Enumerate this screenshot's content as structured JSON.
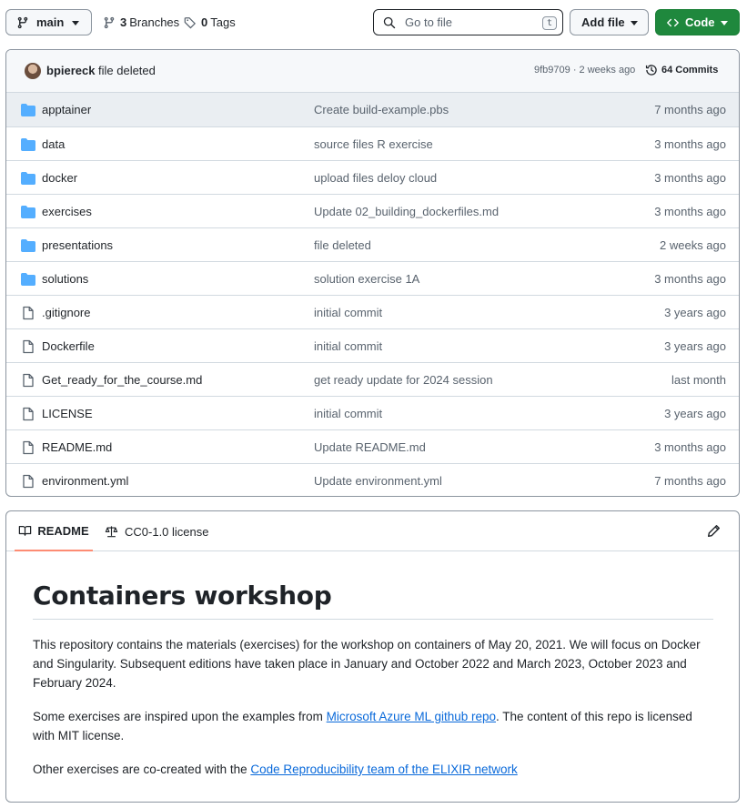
{
  "toolbar": {
    "branch": "main",
    "branches_count": "3",
    "branches_label": "Branches",
    "tags_count": "0",
    "tags_label": "Tags",
    "search_placeholder": "Go to file",
    "search_shortcut": "t",
    "add_file_label": "Add file",
    "code_label": "Code"
  },
  "latest_commit": {
    "author": "bpiereck",
    "message": "file deleted",
    "sha_time": "9fb9709 · 2 weeks ago",
    "commits_count": "64",
    "commits_label": "Commits"
  },
  "files": [
    {
      "type": "folder",
      "name": "apptainer",
      "message": "Create build-example.pbs",
      "age": "7 months ago"
    },
    {
      "type": "folder",
      "name": "data",
      "message": "source files R exercise",
      "age": "3 months ago"
    },
    {
      "type": "folder",
      "name": "docker",
      "message": "upload files deloy cloud",
      "age": "3 months ago"
    },
    {
      "type": "folder",
      "name": "exercises",
      "message": "Update 02_building_dockerfiles.md",
      "age": "3 months ago"
    },
    {
      "type": "folder",
      "name": "presentations",
      "message": "file deleted",
      "age": "2 weeks ago"
    },
    {
      "type": "folder",
      "name": "solutions",
      "message": "solution exercise 1A",
      "age": "3 months ago"
    },
    {
      "type": "file",
      "name": ".gitignore",
      "message": "initial commit",
      "age": "3 years ago"
    },
    {
      "type": "file",
      "name": "Dockerfile",
      "message": "initial commit",
      "age": "3 years ago"
    },
    {
      "type": "file",
      "name": "Get_ready_for_the_course.md",
      "message": "get ready update for 2024 session",
      "age": "last month"
    },
    {
      "type": "file",
      "name": "LICENSE",
      "message": "initial commit",
      "age": "3 years ago"
    },
    {
      "type": "file",
      "name": "README.md",
      "message": "Update README.md",
      "age": "3 months ago"
    },
    {
      "type": "file",
      "name": "environment.yml",
      "message": "Update environment.yml",
      "age": "7 months ago"
    }
  ],
  "readme": {
    "tab_readme": "README",
    "tab_license": "CC0-1.0 license",
    "title": "Containers workshop",
    "p1": "This repository contains the materials (exercises) for the workshop on containers of May 20, 2021. We will focus on Docker and Singularity. Subsequent editions have taken place in January and October 2022 and March 2023, October 2023 and February 2024.",
    "p2_before": "Some exercises are inspired upon the examples from ",
    "p2_link": "Microsoft Azure ML github repo",
    "p2_after": ". The content of this repo is licensed with MIT license.",
    "p3_before": "Other exercises are co-created with the ",
    "p3_link": "Code Reproducibility team of the ELIXIR network"
  },
  "colors": {
    "accent_green": "#1f883d",
    "folder_blue": "#54aeff",
    "link_blue": "#0969da",
    "tab_underline": "#fd8c73"
  }
}
